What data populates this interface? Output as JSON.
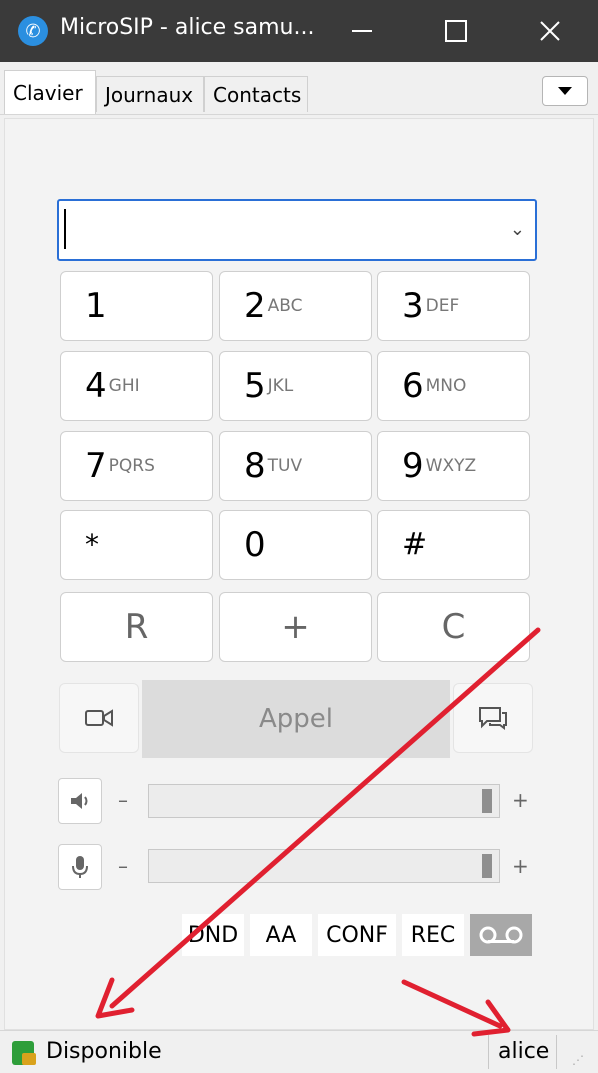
{
  "window": {
    "title": "MicroSIP - alice samu..."
  },
  "tabs": [
    {
      "label": "Clavier",
      "active": true
    },
    {
      "label": "Journaux",
      "active": false
    },
    {
      "label": "Contacts",
      "active": false
    }
  ],
  "dialer": {
    "value": ""
  },
  "keypad": [
    {
      "digit": "1",
      "letters": ""
    },
    {
      "digit": "2",
      "letters": "ABC"
    },
    {
      "digit": "3",
      "letters": "DEF"
    },
    {
      "digit": "4",
      "letters": "GHI"
    },
    {
      "digit": "5",
      "letters": "JKL"
    },
    {
      "digit": "6",
      "letters": "MNO"
    },
    {
      "digit": "7",
      "letters": "PQRS"
    },
    {
      "digit": "8",
      "letters": "TUV"
    },
    {
      "digit": "9",
      "letters": "WXYZ"
    },
    {
      "digit": "*",
      "letters": ""
    },
    {
      "digit": "0",
      "letters": ""
    },
    {
      "digit": "#",
      "letters": ""
    }
  ],
  "function_keys": {
    "redial": "R",
    "plus": "+",
    "clear": "C"
  },
  "call": {
    "label": "Appel"
  },
  "volume": {
    "minus": "–",
    "plus": "+",
    "speaker_level": 0.98,
    "mic_level": 0.98
  },
  "toggles": {
    "dnd": "DND",
    "aa": "AA",
    "conf": "CONF",
    "rec": "REC"
  },
  "status": {
    "presence": "Disponible",
    "account": "alice"
  },
  "colors": {
    "titlebar": "#3a3a3a",
    "focus": "#2a6fd6",
    "annotation": "#e02030",
    "presence": "#2e9e3a"
  }
}
